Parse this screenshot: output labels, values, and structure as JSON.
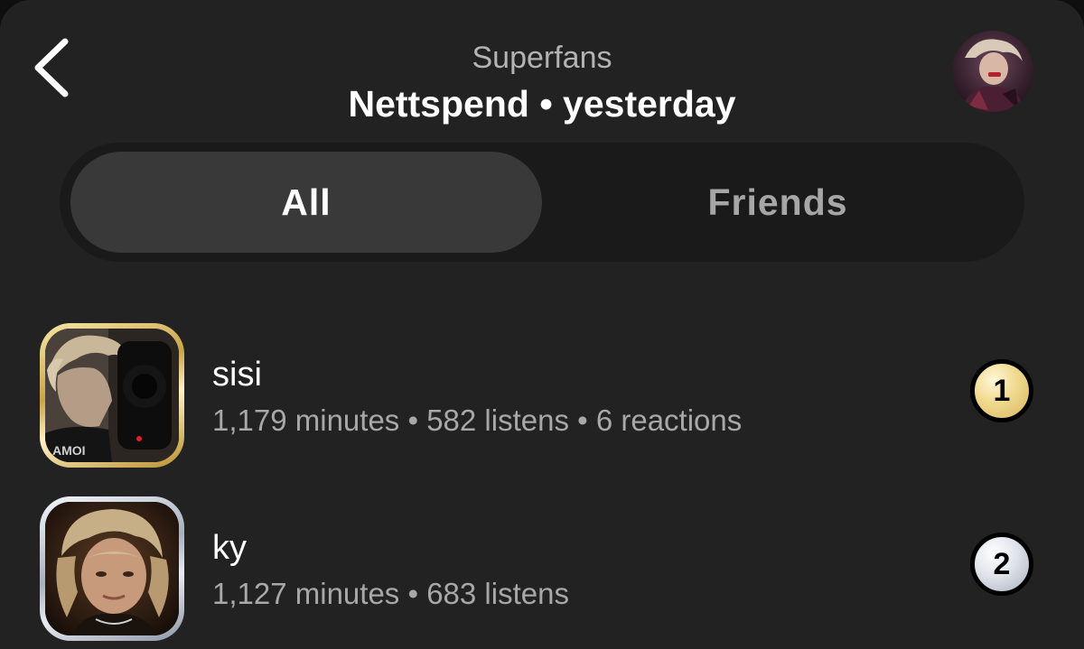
{
  "header": {
    "title": "Superfans",
    "subtitle": "Nettspend • yesterday",
    "back_icon": "chevron-left-icon",
    "avatar": "artist-avatar"
  },
  "tabs": [
    {
      "label": "All",
      "selected": true
    },
    {
      "label": "Friends",
      "selected": false
    }
  ],
  "fans": [
    {
      "rank": "1",
      "name": "sisi",
      "stats": "1,179 minutes • 582 listens • 6 reactions",
      "frame": "gold"
    },
    {
      "rank": "2",
      "name": "ky",
      "stats": "1,127 minutes • 683 listens",
      "frame": "silver"
    }
  ],
  "colors": {
    "background": "#222222",
    "segmented_track": "#1a1a1a",
    "segment_selected": "#393939",
    "text_primary": "#ffffff",
    "text_secondary": "#a8a8a8",
    "gold": "#e6c46a",
    "silver": "#c9ced6"
  }
}
